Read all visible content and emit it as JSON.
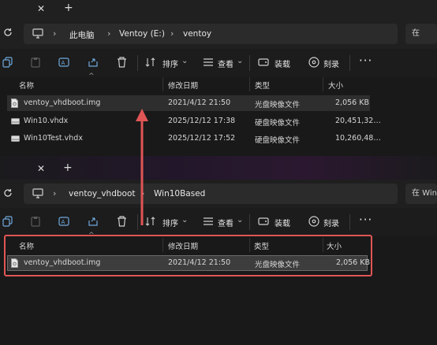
{
  "window1": {
    "breadcrumbs": [
      "此电脑",
      "Ventoy (E:)",
      "ventoy"
    ],
    "search_placeholder": "在 vent",
    "commands": {
      "sort": "排序",
      "view": "查看",
      "mount": "装载",
      "burn": "刻录"
    },
    "columns": [
      "名称",
      "修改日期",
      "类型",
      "大小"
    ],
    "files": [
      {
        "name": "ventoy_vhdboot.img",
        "date": "2021/4/12 21:50",
        "type": "光盘映像文件",
        "size": "2,056 KB",
        "icon": "disc-image-file-icon"
      },
      {
        "name": "Win10.vhdx",
        "date": "2025/12/12 17:38",
        "type": "硬盘映像文件",
        "size": "20,451,32…",
        "icon": "hard-disk-image-icon"
      },
      {
        "name": "Win10Test.vhdx",
        "date": "2025/12/12 17:52",
        "type": "硬盘映像文件",
        "size": "10,260,48…",
        "icon": "hard-disk-image-icon"
      }
    ]
  },
  "window2": {
    "breadcrumbs": [
      "ventoy_vhdboot",
      "Win10Based"
    ],
    "search_placeholder": "在 Win",
    "commands": {
      "sort": "排序",
      "view": "查看",
      "mount": "装载",
      "burn": "刻录"
    },
    "columns": [
      "名称",
      "修改日期",
      "类型",
      "大小"
    ],
    "files": [
      {
        "name": "ventoy_vhdboot.img",
        "date": "2021/4/12 21:50",
        "type": "光盘映像文件",
        "size": "2,056 KB",
        "icon": "disc-image-file-icon"
      }
    ]
  },
  "colors": {
    "accent_callout": "#e05555",
    "arrow": "#e05555"
  }
}
